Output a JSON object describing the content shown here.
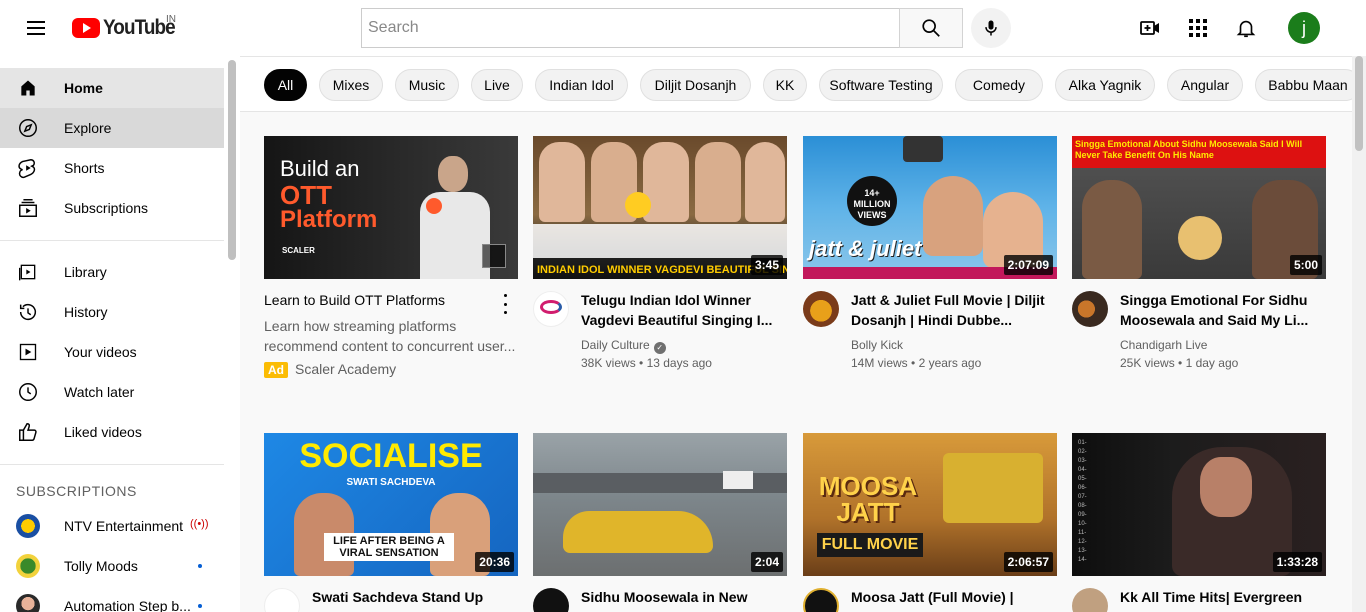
{
  "header": {
    "logo_text": "YouTube",
    "country_code": "IN",
    "search_placeholder": "Search",
    "avatar_letter": "j"
  },
  "sidebar": {
    "main": [
      {
        "label": "Home",
        "icon": "home-icon"
      },
      {
        "label": "Explore",
        "icon": "compass-icon"
      },
      {
        "label": "Shorts",
        "icon": "shorts-icon"
      },
      {
        "label": "Subscriptions",
        "icon": "subscriptions-icon"
      }
    ],
    "library": [
      {
        "label": "Library",
        "icon": "library-icon"
      },
      {
        "label": "History",
        "icon": "history-icon"
      },
      {
        "label": "Your videos",
        "icon": "your-videos-icon"
      },
      {
        "label": "Watch later",
        "icon": "clock-icon"
      },
      {
        "label": "Liked videos",
        "icon": "thumbs-up-icon"
      }
    ],
    "subscriptions_heading": "SUBSCRIPTIONS",
    "subscriptions": [
      {
        "label": "NTV Entertainment",
        "status": "live"
      },
      {
        "label": "Tolly Moods",
        "status": "new"
      },
      {
        "label": "Automation Step b...",
        "status": "new"
      }
    ]
  },
  "chips": [
    "All",
    "Mixes",
    "Music",
    "Live",
    "Indian Idol",
    "Diljit Dosanjh",
    "KK",
    "Software Testing",
    "Comedy",
    "Alka Yagnik",
    "Angular",
    "Babbu Maan"
  ],
  "ad": {
    "thumb_line1": "Build an",
    "thumb_line2": "OTT",
    "thumb_line3": "Platform",
    "thumb_brand": "SCALER",
    "title": "Learn to Build OTT Platforms",
    "description": "Learn how streaming platforms recommend content to concurrent user...",
    "badge": "Ad",
    "channel": "Scaler Academy"
  },
  "videos": [
    {
      "title": "Telugu Indian Idol Winner Vagdevi Beautiful Singing I...",
      "channel": "Daily Culture",
      "verified": true,
      "views": "38K views",
      "age": "13 days ago",
      "duration": "3:45",
      "thumb_caption": "INDIAN IDOL WINNER VAGDEVI BEAUTIFUL SINGING"
    },
    {
      "title": "Jatt & Juliet Full Movie | Diljit Dosanjh | Hindi Dubbe...",
      "channel": "Bolly Kick",
      "verified": false,
      "views": "14M views",
      "age": "2 years ago",
      "duration": "2:07:09",
      "thumb_caption": "jatt & juliet",
      "thumb_badge": "14+ MILLION VIEWS"
    },
    {
      "title": "Singga Emotional For Sidhu Moosewala and Said My Li...",
      "channel": "Chandigarh Live",
      "verified": false,
      "views": "25K views",
      "age": "1 day ago",
      "duration": "5:00",
      "thumb_caption": "Singga Emotional About Sidhu Moosewala Said I Will Never Take Benefit On His Name"
    },
    {
      "title": "Swati Sachdeva Stand Up",
      "channel": "",
      "verified": false,
      "views": "",
      "age": "",
      "duration": "20:36",
      "thumb_caption": "SOCIALISE",
      "thumb_sub": "SWATI SACHDEVA",
      "thumb_banner": "LIFE AFTER BEING A VIRAL SENSATION"
    },
    {
      "title": "Sidhu Moosewala in New",
      "channel": "",
      "verified": false,
      "views": "",
      "age": "",
      "duration": "2:04",
      "thumb_caption": ""
    },
    {
      "title": "Moosa Jatt (Full Movie) |",
      "channel": "",
      "verified": false,
      "views": "",
      "age": "",
      "duration": "2:06:57",
      "thumb_caption": "MOOSA JATT",
      "thumb_banner": "FULL MOVIE"
    },
    {
      "title": "Kk All Time Hits| Evergreen",
      "channel": "",
      "verified": false,
      "views": "",
      "age": "",
      "duration": "1:33:28",
      "thumb_caption": ""
    }
  ],
  "colors": {
    "brand_red": "#ff0000",
    "verified_gray": "#707070",
    "chip_active": "#030303"
  }
}
